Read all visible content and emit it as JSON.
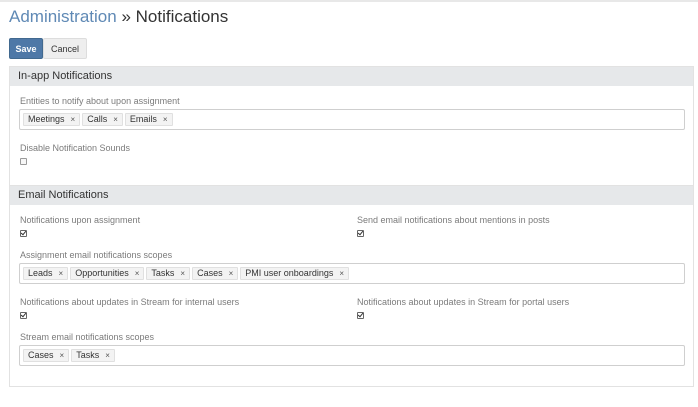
{
  "header": {
    "breadcrumb_link": "Administration",
    "breadcrumb_separator": "»",
    "title": "Notifications"
  },
  "toolbar": {
    "save_label": "Save",
    "cancel_label": "Cancel"
  },
  "in_app": {
    "heading": "In-app Notifications",
    "entities_label": "Entities to notify about upon assignment",
    "entities": [
      "Meetings",
      "Calls",
      "Emails"
    ],
    "disable_sounds_label": "Disable Notification Sounds",
    "disable_sounds_checked": false
  },
  "email": {
    "heading": "Email Notifications",
    "assignment_label": "Notifications upon assignment",
    "assignment_checked": true,
    "mentions_label": "Send email notifications about mentions in posts",
    "mentions_checked": true,
    "assignment_scopes_label": "Assignment email notifications scopes",
    "assignment_scopes": [
      "Leads",
      "Opportunities",
      "Tasks",
      "Cases",
      "PMI user onboardings"
    ],
    "stream_internal_label": "Notifications about updates in Stream for internal users",
    "stream_internal_checked": true,
    "stream_portal_label": "Notifications about updates in Stream for portal users",
    "stream_portal_checked": true,
    "stream_scopes_label": "Stream email notifications scopes",
    "stream_scopes": [
      "Cases",
      "Tasks"
    ]
  },
  "icons": {
    "remove": "×",
    "remove_name": "close-icon",
    "check_name": "checkmark-icon"
  },
  "colors": {
    "link": "#5f89b5",
    "primary_button": "#4e78a7",
    "panel_heading": "#e6e8ea"
  }
}
